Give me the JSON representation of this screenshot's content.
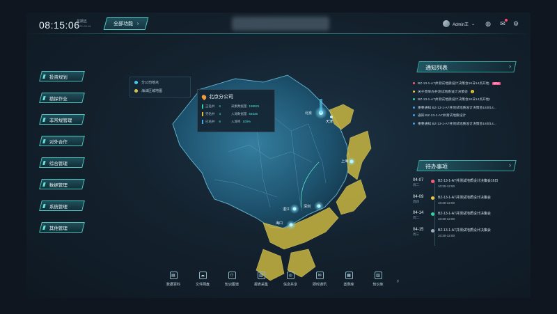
{
  "header": {
    "clock": "08:15:06",
    "weekday": "星期五",
    "date": "2022-09-16",
    "all_functions_label": "全部功能",
    "user_name": "Admin王"
  },
  "nav": {
    "items": [
      "投资规划",
      "勘探作业",
      "非常规管理",
      "对外合作",
      "综合管理",
      "数据管理",
      "系统管理",
      "其他管理"
    ]
  },
  "legend": {
    "items": [
      {
        "label": "分公司地点",
        "color": "#45c6ee"
      },
      {
        "label": "海油区域地图",
        "color": "#d6c44a"
      }
    ]
  },
  "map": {
    "cities": [
      "北京",
      "天津",
      "上海",
      "湛江",
      "深圳",
      "海口"
    ]
  },
  "card": {
    "title": "北京分公司",
    "rows": [
      {
        "k1": "正钻井",
        "v1": "6",
        "c1": "#2fd6a2",
        "k2": "采集数据量",
        "v2": "198921"
      },
      {
        "k1": "完钻井",
        "v1": "3",
        "c1": "#e8b93a",
        "k2": "入湖数据量",
        "v2": "64536"
      },
      {
        "k1": "已钻井",
        "v1": "6",
        "c1": "#3ba8f0",
        "k2": "入湖率",
        "v2": "100%"
      }
    ]
  },
  "notices": {
    "title": "通知列表",
    "items": [
      {
        "text": "BZ-13-1-A7井测试地质设计决策会16日14点开始",
        "color": "#ff5a7a",
        "tag": "NEW"
      },
      {
        "text": "关于周举办井测试地质设计决策会",
        "color": "#e6c93c",
        "info": "!"
      },
      {
        "text": "BZ-13-1-A7井测试地质设计决策会16日14点开始!",
        "color": "#2fd6a2"
      },
      {
        "text": "重要通知   BZ-13-1-A7井测试地质设计决策会16日14...",
        "color": "#4a9ee8"
      },
      {
        "text": "通知   BZ-13-1-A7井测试地质设计",
        "color": "#4a9ee8"
      },
      {
        "text": "重要通知   BZ-13-1-A7井测试地质设计决策会16日14...",
        "color": "#4a9ee8"
      }
    ]
  },
  "todos": {
    "title": "待办事项",
    "items": [
      {
        "date": "04-07",
        "weekday": "周二",
        "text": "BZ-13-1-A7井测试地质设计决策会16日",
        "time": "10:30-12:00",
        "color": "#ff5a7a"
      },
      {
        "date": "04-09",
        "weekday": "周四",
        "text": "BZ-13-1-A7井测试地质设计决策会",
        "time": "10:30-12:00",
        "color": "#e6c93c"
      },
      {
        "date": "04-14",
        "weekday": "周二",
        "text": "BZ-13-1-A7井测试地质设计决策会",
        "time": "10:30-12:00",
        "color": "#2fd6a2"
      },
      {
        "date": "04-15",
        "weekday": "周三",
        "text": "BZ-13-1-A7井测试地质设计决策会",
        "time": "10:30-12:00",
        "color": "#9aa9b3"
      }
    ]
  },
  "toolbar": {
    "items": [
      {
        "label": "数据百科",
        "icon": "book-icon",
        "glyph": "▤"
      },
      {
        "label": "文件网盘",
        "icon": "cloud-icon",
        "glyph": "☁"
      },
      {
        "label": "知识图谱",
        "icon": "graph-icon",
        "glyph": "⚇"
      },
      {
        "label": "报表采集",
        "icon": "report-icon",
        "glyph": "▥"
      },
      {
        "label": "信息共享",
        "icon": "share-icon",
        "glyph": "◎"
      },
      {
        "label": "即时通讯",
        "icon": "chat-icon",
        "glyph": "✉"
      },
      {
        "label": "案例库",
        "icon": "case-icon",
        "glyph": "▦"
      },
      {
        "label": "知识库",
        "icon": "library-icon",
        "glyph": "▥"
      }
    ]
  }
}
